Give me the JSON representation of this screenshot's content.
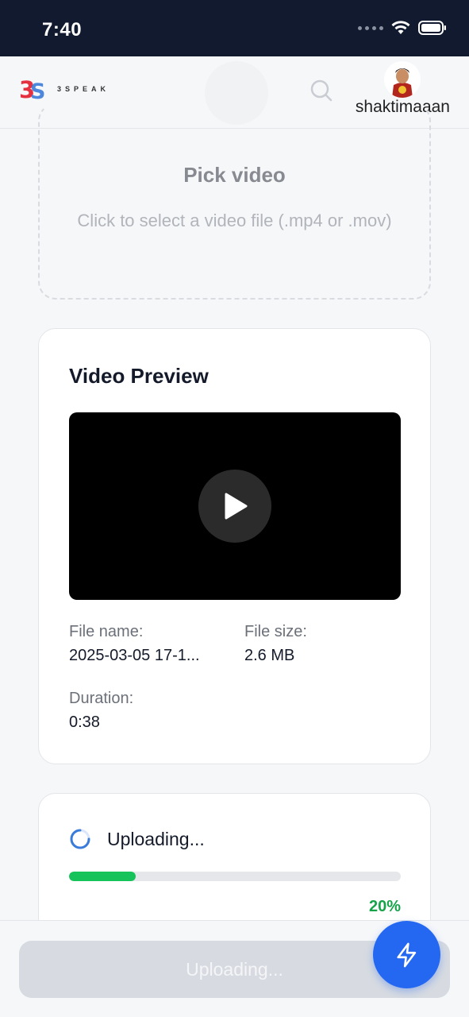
{
  "status_bar": {
    "time": "7:40"
  },
  "header": {
    "logo_text": "3SPEAK",
    "username": "shaktimaaan"
  },
  "pick": {
    "title": "Pick video",
    "subtitle": "Click to select a video file (.mp4 or .mov)"
  },
  "preview": {
    "title": "Video Preview",
    "file_name_label": "File name:",
    "file_name_value": "2025-03-05 17-1...",
    "file_size_label": "File size:",
    "file_size_value": "2.6 MB",
    "duration_label": "Duration:",
    "duration_value": "0:38"
  },
  "upload": {
    "status": "Uploading...",
    "progress": 0.2,
    "percent_label": "20%"
  },
  "bottom": {
    "button_label": "Uploading..."
  },
  "colors": {
    "status_bar_bg": "#111a2e",
    "accent_blue": "#2468f2",
    "progress_green": "#16c25a",
    "percent_green": "#16a34a",
    "logo_red": "#e5303f",
    "logo_blue": "#3b7bd9"
  },
  "icons": {
    "search": "search-icon",
    "play": "play-icon",
    "spinner": "spinner-icon",
    "fab": "lightning-icon"
  }
}
